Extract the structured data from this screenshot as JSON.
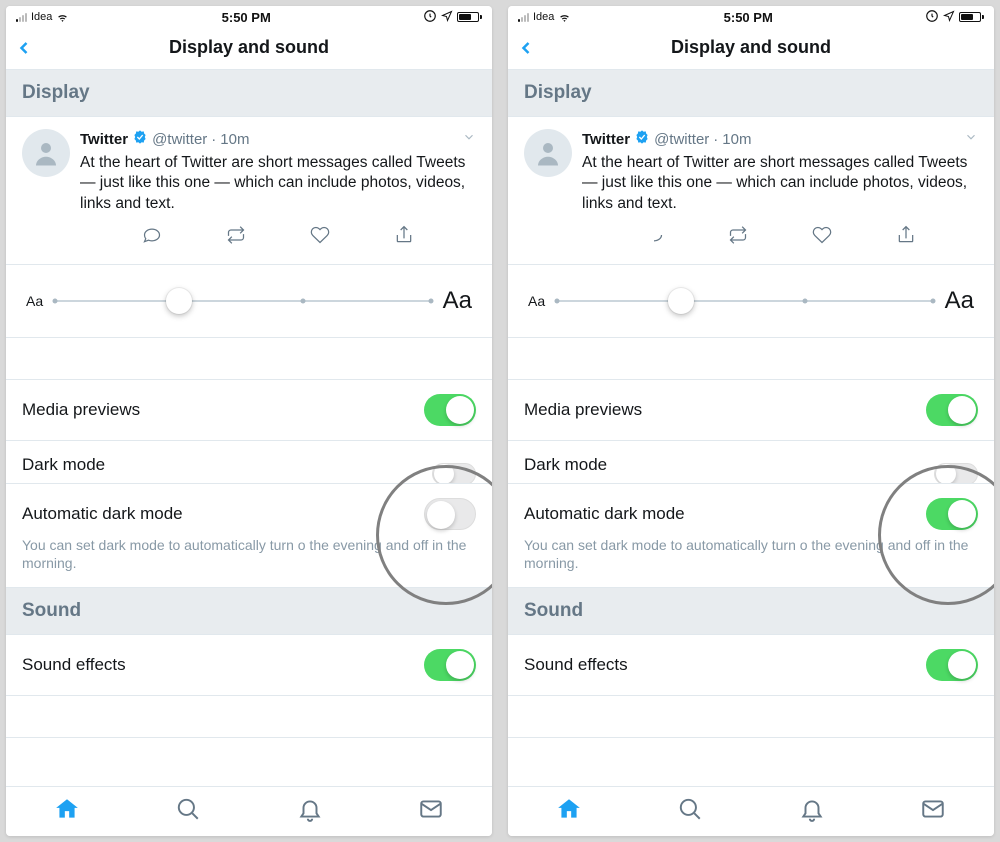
{
  "status": {
    "carrier": "Idea",
    "time": "5:50 PM"
  },
  "nav": {
    "title": "Display and sound"
  },
  "sections": {
    "display": "Display",
    "sound": "Sound"
  },
  "tweet": {
    "name": "Twitter",
    "handle": "@twitter",
    "dot": "·",
    "age": "10m",
    "text": "At the heart of Twitter are short messages called Tweets — just like this one — which can include photos, videos, links and text."
  },
  "slider": {
    "small": "Aa",
    "large": "Aa"
  },
  "settings": {
    "media_previews": "Media previews",
    "dark_mode": "Dark mode",
    "auto_dark_mode": "Automatic dark mode",
    "auto_dark_mode_sub": "You can set dark mode to automatically turn o      the evening and off in the morning.",
    "sound_effects": "Sound effects"
  },
  "screens": [
    {
      "auto_dark_on": false
    },
    {
      "auto_dark_on": true
    }
  ]
}
